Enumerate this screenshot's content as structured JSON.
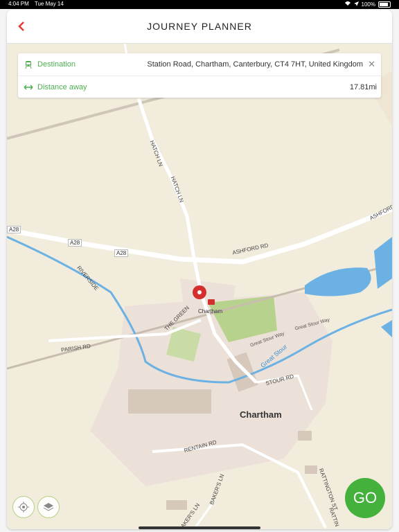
{
  "status_bar": {
    "time": "4:04 PM",
    "date": "Tue May 14",
    "battery": "100%"
  },
  "header": {
    "title": "JOURNEY PLANNER",
    "back_icon": "chevron-left-icon"
  },
  "info_panel": {
    "destination_label": "Destination",
    "destination_value": "Station Road, Chartham, Canterbury, CT4 7HT, United Kingdom",
    "distance_label": "Distance away",
    "distance_value": "17.81mi"
  },
  "map": {
    "road_labels": {
      "hatch_ln_1": "HATCH LN",
      "hatch_ln_2": "HATCH LN",
      "a28_1": "A28",
      "a28_2": "A28",
      "a28_3": "A28",
      "ashford_rd": "ASHFORD RD",
      "ashford": "ASHFORD",
      "riverside": "RIVERSIDE",
      "the_green": "THE GREEN",
      "parish_rd": "PARISH RD",
      "great_stour_way_1": "Great Stour Way",
      "great_stour_way_2": "Great Stour Way",
      "great_stour": "Great Stour",
      "stour_rd": "STOUR RD",
      "rentain_rd": "RENTAIN RD",
      "bakers_ln_1": "BAKER'S LN",
      "bakers_ln_2": "BAKER'S LN",
      "rattington_st": "RATTINGTON ST",
      "ratting": "RATTIN"
    },
    "station_label": "Chartham",
    "town_label": "Chartham",
    "colors": {
      "land": "#f2ecdd",
      "road": "#ffffff",
      "water": "#6bb1e3",
      "park": "#c9dca5",
      "urban": "#ebe1d8",
      "marker": "#d32f2f"
    }
  },
  "buttons": {
    "go": "GO",
    "locate_icon": "locate-icon",
    "layers_icon": "layers-icon"
  },
  "accent": "#e53935",
  "brand_green": "#43b13b"
}
